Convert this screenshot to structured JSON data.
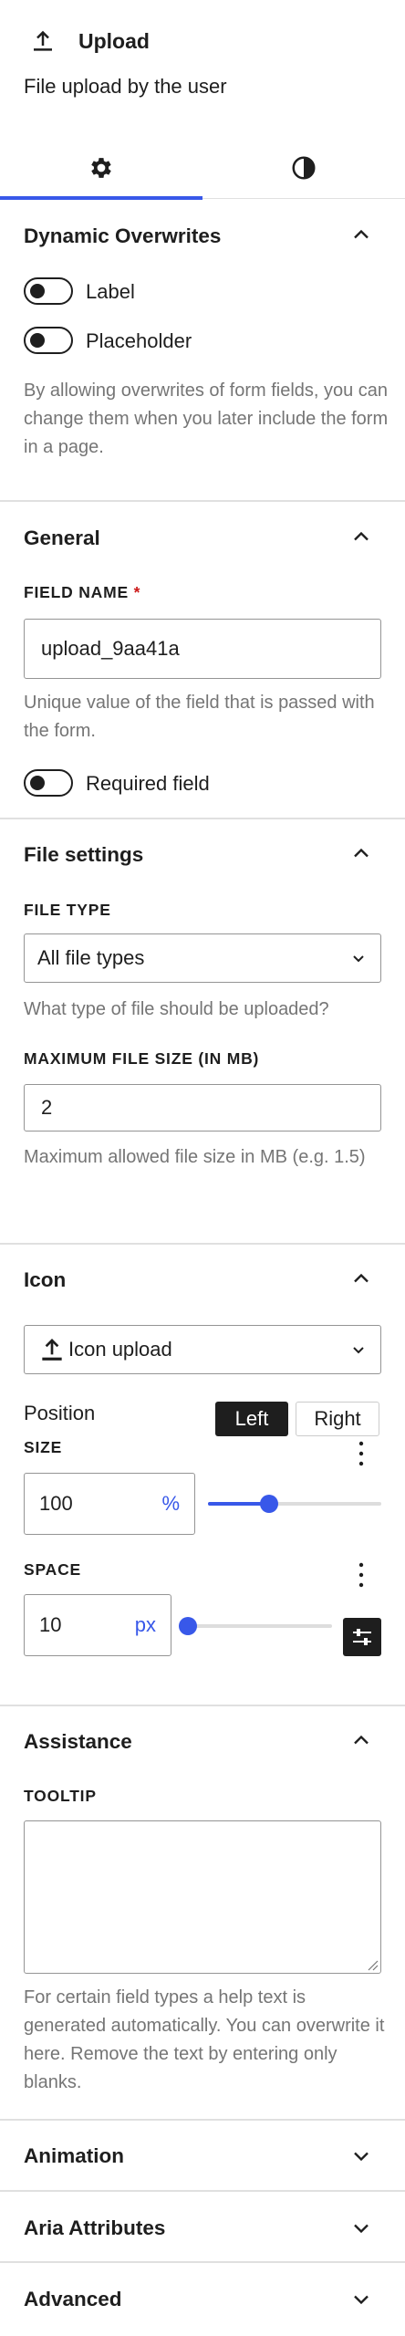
{
  "header": {
    "title": "Upload",
    "description": "File upload by the user",
    "icon": "upload-icon"
  },
  "tabs": [
    {
      "name": "settings",
      "icon": "gear-icon",
      "active": true
    },
    {
      "name": "styles",
      "icon": "contrast-icon",
      "active": false
    }
  ],
  "dynamic_overwrites": {
    "title": "Dynamic Overwrites",
    "expanded": true,
    "toggles": [
      {
        "label": "Label",
        "on": false
      },
      {
        "label": "Placeholder",
        "on": false
      }
    ],
    "help": "By allowing overwrites of form fields, you can change them when you later include the form in a page."
  },
  "general": {
    "title": "General",
    "expanded": true,
    "field_name_label": "FIELD NAME",
    "required_mark": "*",
    "field_name_value": "upload_9aa41a",
    "field_name_help": "Unique value of the field that is passed with the form.",
    "required_toggle_label": "Required field",
    "required_on": false
  },
  "file_settings": {
    "title": "File settings",
    "expanded": true,
    "file_type_label": "FILE TYPE",
    "file_type_value": "All file types",
    "file_type_help": "What type of file should be uploaded?",
    "max_size_label": "MAXIMUM FILE SIZE (IN MB)",
    "max_size_value": "2",
    "max_size_help": "Maximum allowed file size in MB (e.g. 1.5)"
  },
  "icon_panel": {
    "title": "Icon",
    "expanded": true,
    "icon_select_value": "Icon upload",
    "position_label": "Position",
    "position_options": [
      "Left",
      "Right"
    ],
    "position_selected": "Left",
    "size_label": "SIZE",
    "size_value": "100",
    "size_unit": "%",
    "size_slider_fraction": 0.33,
    "space_label": "SPACE",
    "space_value": "10",
    "space_unit": "px",
    "space_slider_fraction": 0.0
  },
  "assistance": {
    "title": "Assistance",
    "expanded": true,
    "tooltip_label": "TOOLTIP",
    "tooltip_value": "",
    "tooltip_help": "For certain field types a help text is generated automatically. You can overwrite it here. Remove the text by entering only blanks."
  },
  "collapsed_panels": [
    {
      "title": "Animation"
    },
    {
      "title": "Aria Attributes"
    },
    {
      "title": "Advanced"
    }
  ],
  "colors": {
    "accent": "#3858e9",
    "text": "#1e1e1e",
    "muted": "#757575",
    "border": "#e0e0e0",
    "required": "#cc1818"
  }
}
